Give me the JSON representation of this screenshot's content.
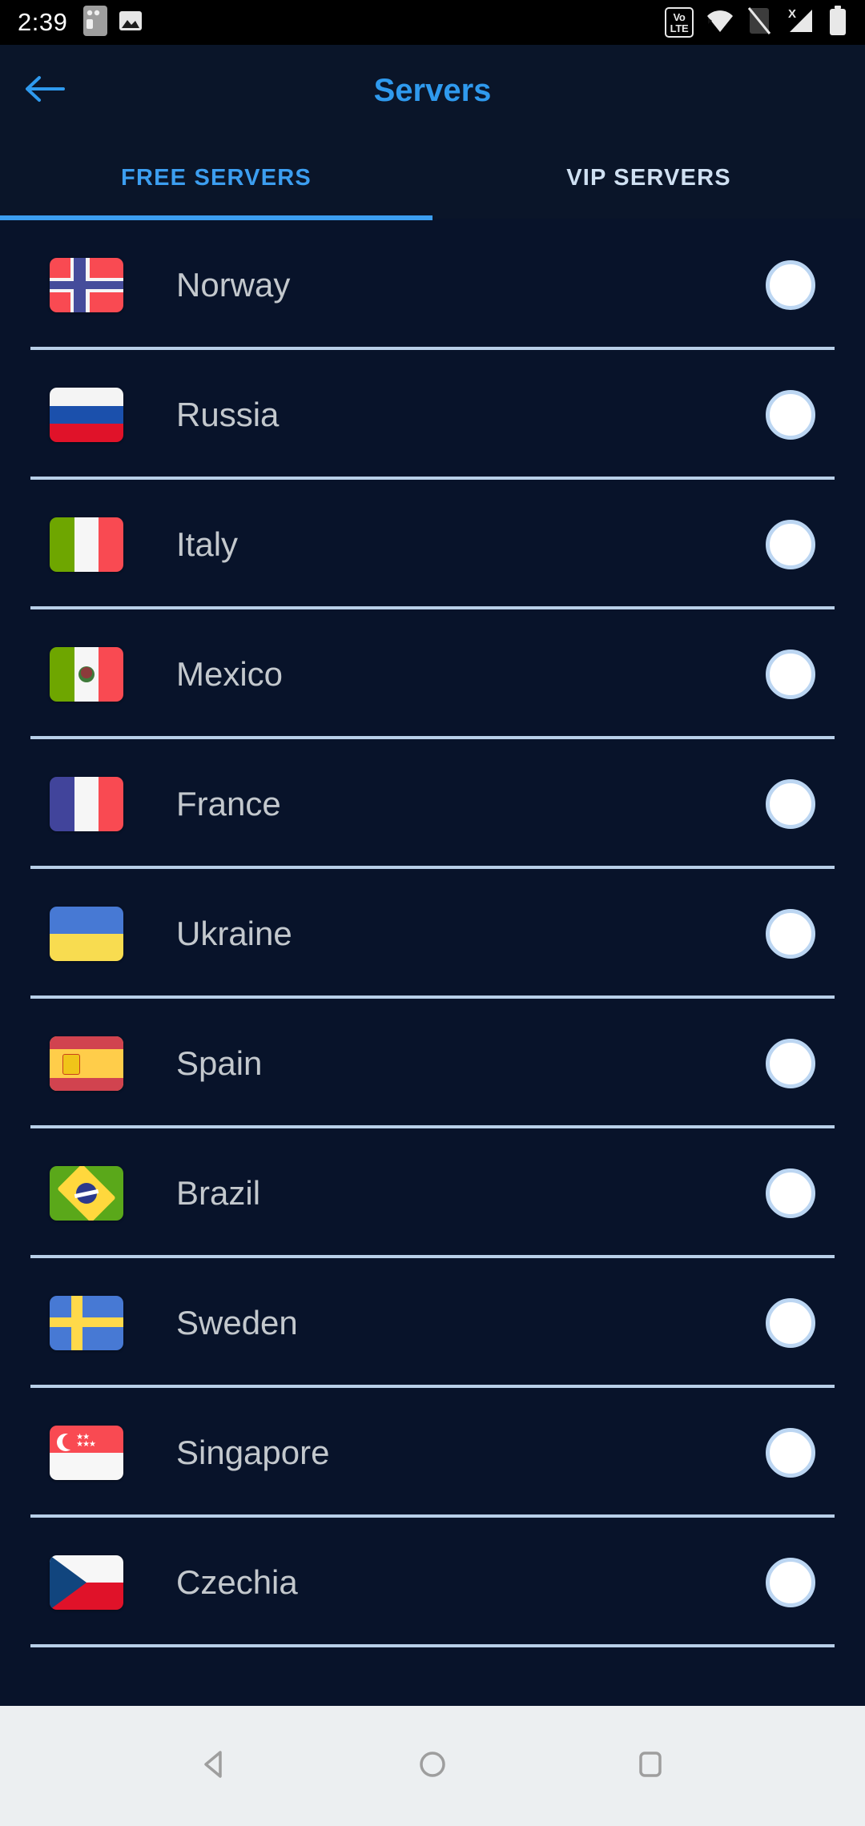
{
  "statusbar": {
    "time": "2:39",
    "left_icons": [
      "sim-card-icon",
      "image-icon"
    ],
    "right_icons": [
      "volte-icon",
      "wifi-icon",
      "sim-off-icon",
      "signal-no-service-icon",
      "battery-icon"
    ],
    "volte_line1": "Vo",
    "volte_line2": "LTE",
    "signal_x": "X"
  },
  "appbar": {
    "back_icon": "back-arrow-icon",
    "title": "Servers",
    "title_color": "#2f9aee"
  },
  "tabs": {
    "items": [
      {
        "label": "FREE SERVERS",
        "active": true
      },
      {
        "label": "VIP SERVERS",
        "active": false
      }
    ],
    "active_color": "#3c9ef0",
    "inactive_color": "#cfe0f2",
    "indicator_color": "#3c9ef0"
  },
  "servers": {
    "items": [
      {
        "name": "Norway",
        "flag": "flag-norway",
        "selected": false
      },
      {
        "name": "Russia",
        "flag": "flag-russia",
        "selected": false
      },
      {
        "name": "Italy",
        "flag": "flag-italy",
        "selected": false
      },
      {
        "name": "Mexico",
        "flag": "flag-mexico",
        "selected": false
      },
      {
        "name": "France",
        "flag": "flag-france",
        "selected": false
      },
      {
        "name": "Ukraine",
        "flag": "flag-ukraine",
        "selected": false
      },
      {
        "name": "Spain",
        "flag": "flag-spain",
        "selected": false
      },
      {
        "name": "Brazil",
        "flag": "flag-brazil",
        "selected": false
      },
      {
        "name": "Sweden",
        "flag": "flag-sweden",
        "selected": false
      },
      {
        "name": "Singapore",
        "flag": "flag-singapore",
        "selected": false
      },
      {
        "name": "Czechia",
        "flag": "flag-czechia",
        "selected": false
      }
    ]
  },
  "navbar": {
    "buttons": [
      "back-nav-icon",
      "home-nav-icon",
      "recents-nav-icon"
    ]
  },
  "colors": {
    "background": "#08132a",
    "appbar_background": "#0a1529",
    "divider": "#b8cfe8",
    "country_text": "#c3c8cd",
    "radio_ring": "#bcd6f2",
    "navbar_background": "#eceff1"
  }
}
